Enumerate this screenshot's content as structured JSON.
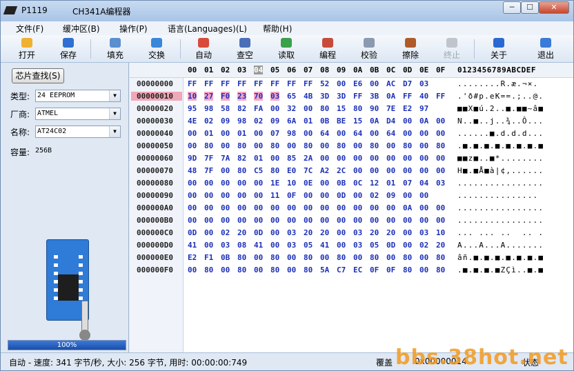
{
  "window": {
    "app_name": "P1119",
    "title": "CH341A编程器",
    "min": "─",
    "max": "☐",
    "close": "✕"
  },
  "menu": [
    "文件(F)",
    "缓冲区(B)",
    "操作(P)",
    "语言(Languages)(L)",
    "帮助(H)"
  ],
  "toolbar": [
    {
      "name": "open",
      "label": "打开",
      "color": "#f0b030",
      "enabled": true
    },
    {
      "name": "save",
      "label": "保存",
      "color": "#2f6fd0",
      "enabled": true
    },
    {
      "name": "fill",
      "label": "填充",
      "color": "#5a8fd0",
      "enabled": true
    },
    {
      "name": "swap",
      "label": "交换",
      "color": "#3a86d8",
      "enabled": true
    },
    {
      "name": "auto",
      "label": "自动",
      "color": "#d84a3a",
      "enabled": true
    },
    {
      "name": "blank-check",
      "label": "查空",
      "color": "#4a6fb8",
      "enabled": true
    },
    {
      "name": "read",
      "label": "读取",
      "color": "#3aa04a",
      "enabled": true
    },
    {
      "name": "program",
      "label": "编程",
      "color": "#c84a3a",
      "enabled": true
    },
    {
      "name": "verify",
      "label": "校验",
      "color": "#8a9ab0",
      "enabled": true
    },
    {
      "name": "erase",
      "label": "擦除",
      "color": "#b05a2a",
      "enabled": true
    },
    {
      "name": "stop",
      "label": "终止",
      "color": "#c0c4cc",
      "enabled": false
    },
    {
      "name": "about",
      "label": "关于",
      "color": "#2a6ad0",
      "enabled": true
    },
    {
      "name": "exit",
      "label": "退出",
      "color": "#3a7ad8",
      "enabled": true
    }
  ],
  "sidebar": {
    "find_button": "芯片查找(S)",
    "type_label": "类型:",
    "type_value": "24 EEPROM",
    "vendor_label": "厂商:",
    "vendor_value": "ATMEL",
    "name_label": "名称:",
    "name_value": "AT24C02",
    "capacity_label": "容量:",
    "capacity_value": "256B",
    "progress_text": "100%",
    "progress_fraction": 1.0
  },
  "hex": {
    "columns": [
      "00",
      "01",
      "02",
      "03",
      "04",
      "05",
      "06",
      "07",
      "08",
      "09",
      "0A",
      "0B",
      "0C",
      "0D",
      "0E",
      "0F"
    ],
    "cursor_column": 4,
    "ascii_header": "0123456789ABCDEF",
    "selected_row": 1,
    "highlight": {
      "row": 1,
      "from": 0,
      "to": 5
    },
    "rows": [
      {
        "addr": "00000000",
        "bytes": [
          "FF",
          "FF",
          "FF",
          "FF",
          "FF",
          "FF",
          "FF",
          "FF",
          "52",
          "00",
          "E6",
          "00",
          "AC",
          "D7",
          "03",
          ""
        ],
        "ascii": "........R.æ.¬×."
      },
      {
        "addr": "00000010",
        "bytes": [
          "10",
          "27",
          "F0",
          "23",
          "70",
          "03",
          "65",
          "4B",
          "3D",
          "3D",
          "FF",
          "3B",
          "0A",
          "FF",
          "40",
          "FF"
        ],
        "ascii": ".'ð#p.eK==.;..@."
      },
      {
        "addr": "00000020",
        "bytes": [
          "95",
          "98",
          "58",
          "82",
          "FA",
          "00",
          "32",
          "00",
          "80",
          "15",
          "80",
          "90",
          "7E",
          "E2",
          "97",
          ""
        ],
        "ascii": "■■X■ú.2..■.■■~â■"
      },
      {
        "addr": "00000030",
        "bytes": [
          "4E",
          "02",
          "09",
          "98",
          "02",
          "09",
          "6A",
          "01",
          "0B",
          "BE",
          "15",
          "0A",
          "D4",
          "00",
          "0A",
          "00"
        ],
        "ascii": "N..■..j..¾..Ô..."
      },
      {
        "addr": "00000040",
        "bytes": [
          "00",
          "01",
          "00",
          "01",
          "00",
          "07",
          "98",
          "00",
          "64",
          "00",
          "64",
          "00",
          "64",
          "00",
          "00",
          "00"
        ],
        "ascii": "......■.d.d.d..."
      },
      {
        "addr": "00000050",
        "bytes": [
          "00",
          "80",
          "00",
          "80",
          "00",
          "80",
          "00",
          "80",
          "00",
          "80",
          "00",
          "80",
          "00",
          "80",
          "00",
          "80"
        ],
        "ascii": ".■.■.■.■.■.■.■.■"
      },
      {
        "addr": "00000060",
        "bytes": [
          "9D",
          "7F",
          "7A",
          "82",
          "01",
          "00",
          "85",
          "2A",
          "00",
          "00",
          "00",
          "00",
          "00",
          "00",
          "00",
          "00"
        ],
        "ascii": "■■z■..■*........"
      },
      {
        "addr": "00000070",
        "bytes": [
          "48",
          "7F",
          "00",
          "80",
          "C5",
          "80",
          "E0",
          "7C",
          "A2",
          "2C",
          "00",
          "00",
          "00",
          "00",
          "00",
          "00"
        ],
        "ascii": "H■.■Å■à|¢,......"
      },
      {
        "addr": "00000080",
        "bytes": [
          "00",
          "00",
          "00",
          "00",
          "00",
          "1E",
          "10",
          "0E",
          "00",
          "0B",
          "0C",
          "12",
          "01",
          "07",
          "04",
          "03"
        ],
        "ascii": "................"
      },
      {
        "addr": "00000090",
        "bytes": [
          "00",
          "00",
          "00",
          "00",
          "00",
          "11",
          "0F",
          "00",
          "00",
          "0D",
          "00",
          "02",
          "09",
          "00",
          "00",
          ""
        ],
        "ascii": "..............."
      },
      {
        "addr": "000000A0",
        "bytes": [
          "00",
          "00",
          "00",
          "00",
          "00",
          "00",
          "00",
          "00",
          "00",
          "00",
          "00",
          "00",
          "00",
          "0A",
          "00",
          "00"
        ],
        "ascii": "................"
      },
      {
        "addr": "000000B0",
        "bytes": [
          "00",
          "00",
          "00",
          "00",
          "00",
          "00",
          "00",
          "00",
          "00",
          "00",
          "00",
          "00",
          "00",
          "00",
          "00",
          "00"
        ],
        "ascii": "................"
      },
      {
        "addr": "000000C0",
        "bytes": [
          "0D",
          "00",
          "02",
          "20",
          "0D",
          "00",
          "03",
          "20",
          "20",
          "00",
          "03",
          "20",
          "20",
          "00",
          "03",
          "10"
        ],
        "ascii": "... ... ..  .. ."
      },
      {
        "addr": "000000D0",
        "bytes": [
          "41",
          "00",
          "03",
          "08",
          "41",
          "00",
          "03",
          "05",
          "41",
          "00",
          "03",
          "05",
          "0D",
          "00",
          "02",
          "20"
        ],
        "ascii": "A...A...A......."
      },
      {
        "addr": "000000E0",
        "bytes": [
          "E2",
          "F1",
          "0B",
          "80",
          "00",
          "80",
          "00",
          "80",
          "00",
          "80",
          "00",
          "80",
          "00",
          "80",
          "00",
          "80"
        ],
        "ascii": "âñ.■.■.■.■.■.■.■"
      },
      {
        "addr": "000000F0",
        "bytes": [
          "00",
          "80",
          "00",
          "80",
          "00",
          "80",
          "00",
          "80",
          "5A",
          "C7",
          "EC",
          "0F",
          "0F",
          "80",
          "00",
          "80"
        ],
        "ascii": ".■.■.■.■ZÇì..■.■"
      }
    ]
  },
  "status": {
    "left": "自动 - 速度: 341 字节/秒, 大小: 256 字节, 用时: 00:00:00:749",
    "mode": "覆盖",
    "offset": "0x00000014",
    "state": "状态"
  },
  "watermark": "bbs.38hot.net"
}
